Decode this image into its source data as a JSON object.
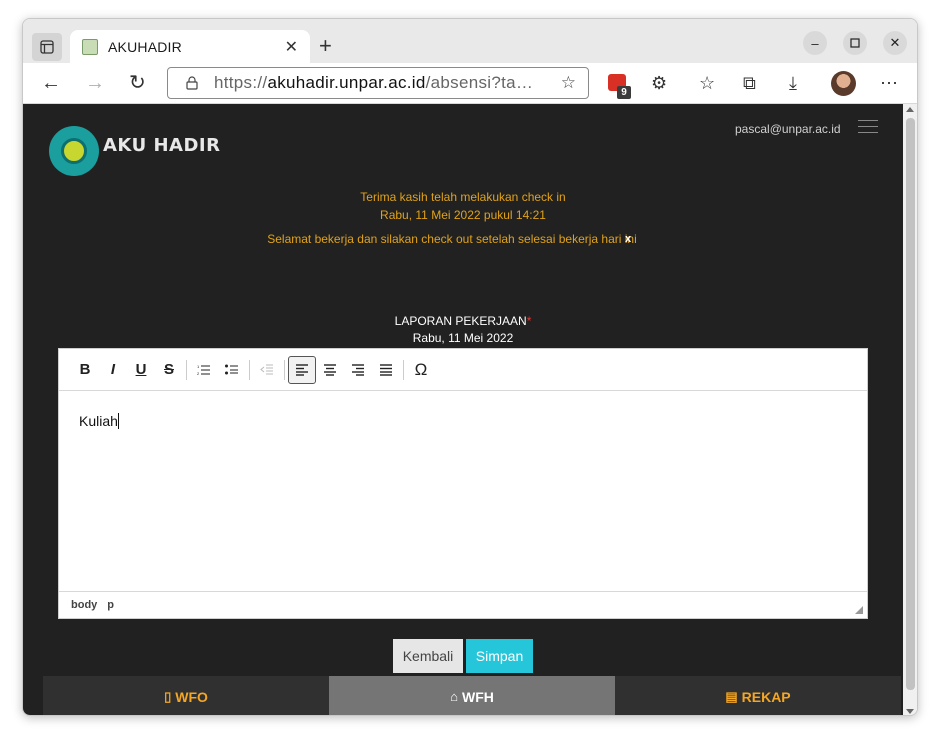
{
  "browser": {
    "tab_title": "AKUHADIR",
    "url_prefix": "https://",
    "url_domain": "akuhadir.unpar.ac.id",
    "url_path": "/absensi?ta…",
    "extension_badge": "9"
  },
  "header": {
    "logo_text": "AKU HADIR",
    "user_email": "pascal@unpar.ac.id"
  },
  "notice": {
    "line1": "Terima kasih telah melakukan check in",
    "line2": "Rabu, 11 Mei 2022 pukul 14:21",
    "line3": "Selamat bekerja dan silakan check out setelah selesai bekerja hari ini",
    "close": "x"
  },
  "report": {
    "label": "LAPORAN PEKERJAAN",
    "required_mark": "*",
    "date": "Rabu, 11 Mei 2022",
    "content": "Kuliah",
    "status_path": [
      "body",
      "p"
    ]
  },
  "toolbar": {
    "bold": "B",
    "italic": "I",
    "underline": "U",
    "strike": "S",
    "special_char": "Ω"
  },
  "buttons": {
    "back": "Kembali",
    "save": "Simpan"
  },
  "bottom_nav": {
    "wfo": "WFO",
    "wfh": "WFH",
    "rekap": "REKAP"
  },
  "colors": {
    "page_bg": "#212121",
    "notice": "#e0a21b",
    "accent": "#26c6da",
    "nav_active": "#757575",
    "nav_text": "#f5a623"
  }
}
